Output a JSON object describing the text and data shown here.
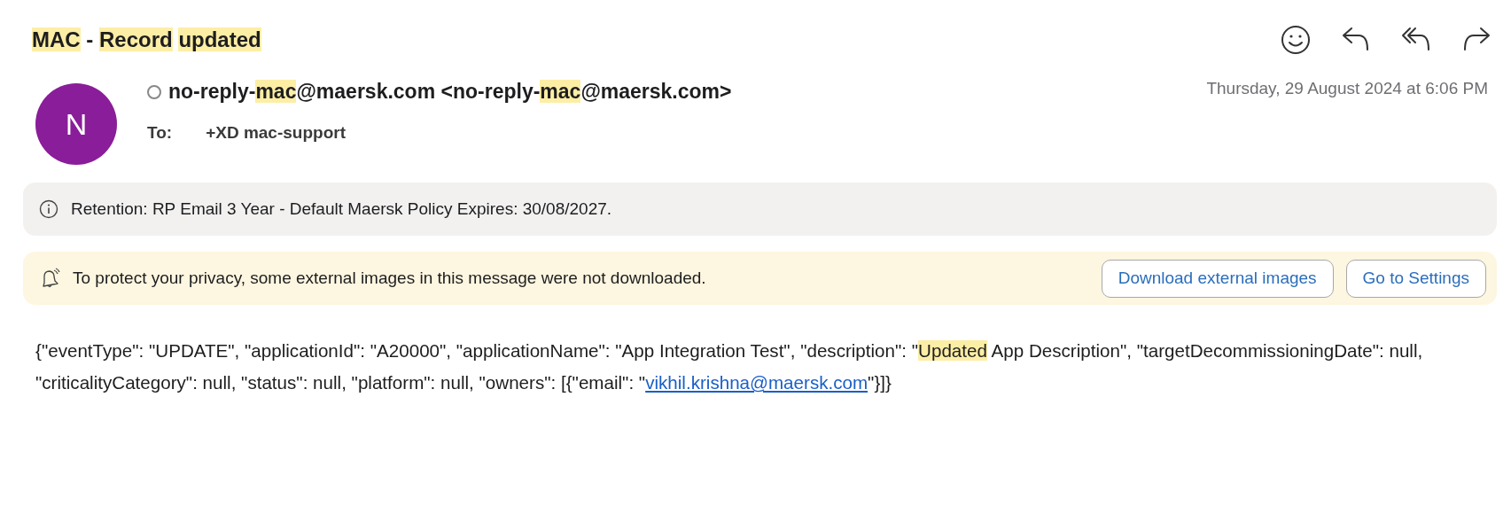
{
  "subject": [
    {
      "kind": "highlight",
      "text": "MAC"
    },
    {
      "kind": "text",
      "text": " - "
    },
    {
      "kind": "highlight",
      "text": "Record"
    },
    {
      "kind": "highlight",
      "text": "updated"
    }
  ],
  "sender": {
    "avatar": "N",
    "read": false,
    "name": [
      {
        "kind": "text",
        "text": "no-reply-"
      },
      {
        "kind": "highlight",
        "text": "mac"
      },
      {
        "kind": "text",
        "text": "@maersk.com <no-reply-"
      },
      {
        "kind": "highlight",
        "text": "mac"
      },
      {
        "kind": "text",
        "text": "@maersk.com>"
      }
    ],
    "date": "Thursday, 29 August 2024 at 6:06 PM",
    "to_label": "To:",
    "to": "+XD mac-support"
  },
  "retention": {
    "text": "Retention: RP Email 3 Year - Default Maersk Policy Expires: 30/08/2027."
  },
  "privacy": {
    "text": "To protect your privacy, some external images in this message were not downloaded.",
    "buttons": [
      "Download external images",
      "Go to Settings"
    ]
  },
  "body": [
    {
      "kind": "text",
      "text": "{\"eventType\": \"UPDATE\", \"applicationId\": \"A20000\", \"applicationName\": \"App Integration Test\", \"description\": \""
    },
    {
      "kind": "highlight",
      "text": "Updated"
    },
    {
      "kind": "text",
      "text": " App Description\", \"targetDecommissioningDate\": null, \"criticalityCategory\": null, \"status\": null, \"platform\": null, \"owners\": [{\"email\": \""
    },
    {
      "kind": "link",
      "text": "vikhil.krishna@maersk.com"
    },
    {
      "kind": "text",
      "text": "\"}]}"
    }
  ]
}
